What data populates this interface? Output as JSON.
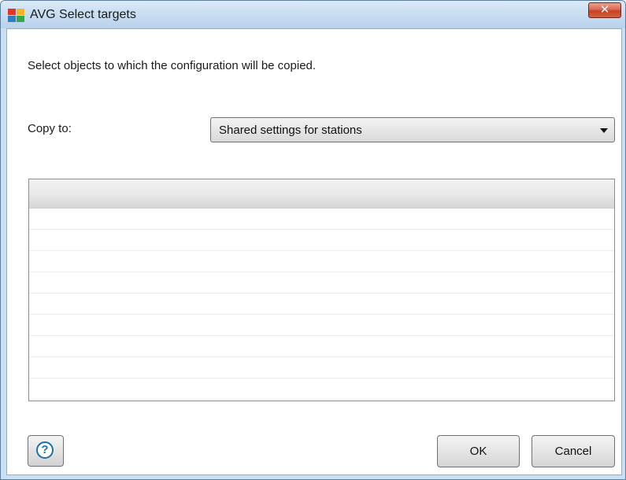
{
  "window": {
    "title": "AVG Select targets",
    "close_label": "✕"
  },
  "dialog": {
    "instruction": "Select objects to which the configuration will be copied.",
    "copy_to_label": "Copy to:",
    "copy_to_selected": "Shared settings for stations"
  },
  "buttons": {
    "help_label": "?",
    "ok_label": "OK",
    "cancel_label": "Cancel"
  },
  "icons": {
    "app": "avg-logo-icon",
    "close": "close-icon",
    "dropdown": "chevron-down-icon",
    "help": "help-icon"
  },
  "colors": {
    "title_bar": "#c6dcf1",
    "close_button": "#c63f24",
    "help_icon": "#1d6fa8"
  }
}
